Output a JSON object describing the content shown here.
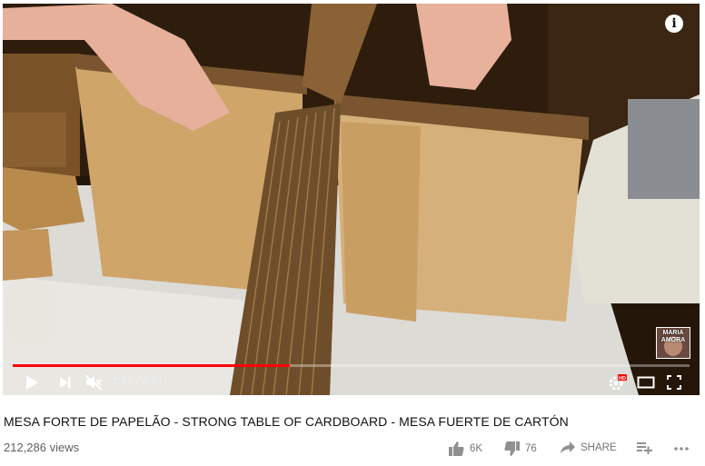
{
  "video": {
    "channel_watermark": "MARIA\nAMORA",
    "progress": {
      "current_time": "1:59",
      "separator": " / ",
      "duration": "4:51",
      "played_fraction": 0.41
    },
    "colors": {
      "played": "#ff0000",
      "track": "#ffffff"
    },
    "icons": [
      "info-icon",
      "play-icon",
      "next-icon",
      "mute-icon",
      "settings-icon",
      "hd-badge",
      "theater-icon",
      "fullscreen-icon"
    ]
  },
  "meta": {
    "title": "MESA FORTE DE PAPELÃO - STRONG TABLE OF CARDBOARD - MESA FUERTE DE CARTÓN",
    "views": "212,286 views"
  },
  "actions": {
    "like_count": "6K",
    "dislike_count": "76",
    "share_label": "SHARE",
    "icons": [
      "thumbs-up-icon",
      "thumbs-down-icon",
      "share-icon",
      "add-to-playlist-icon",
      "more-icon"
    ]
  }
}
